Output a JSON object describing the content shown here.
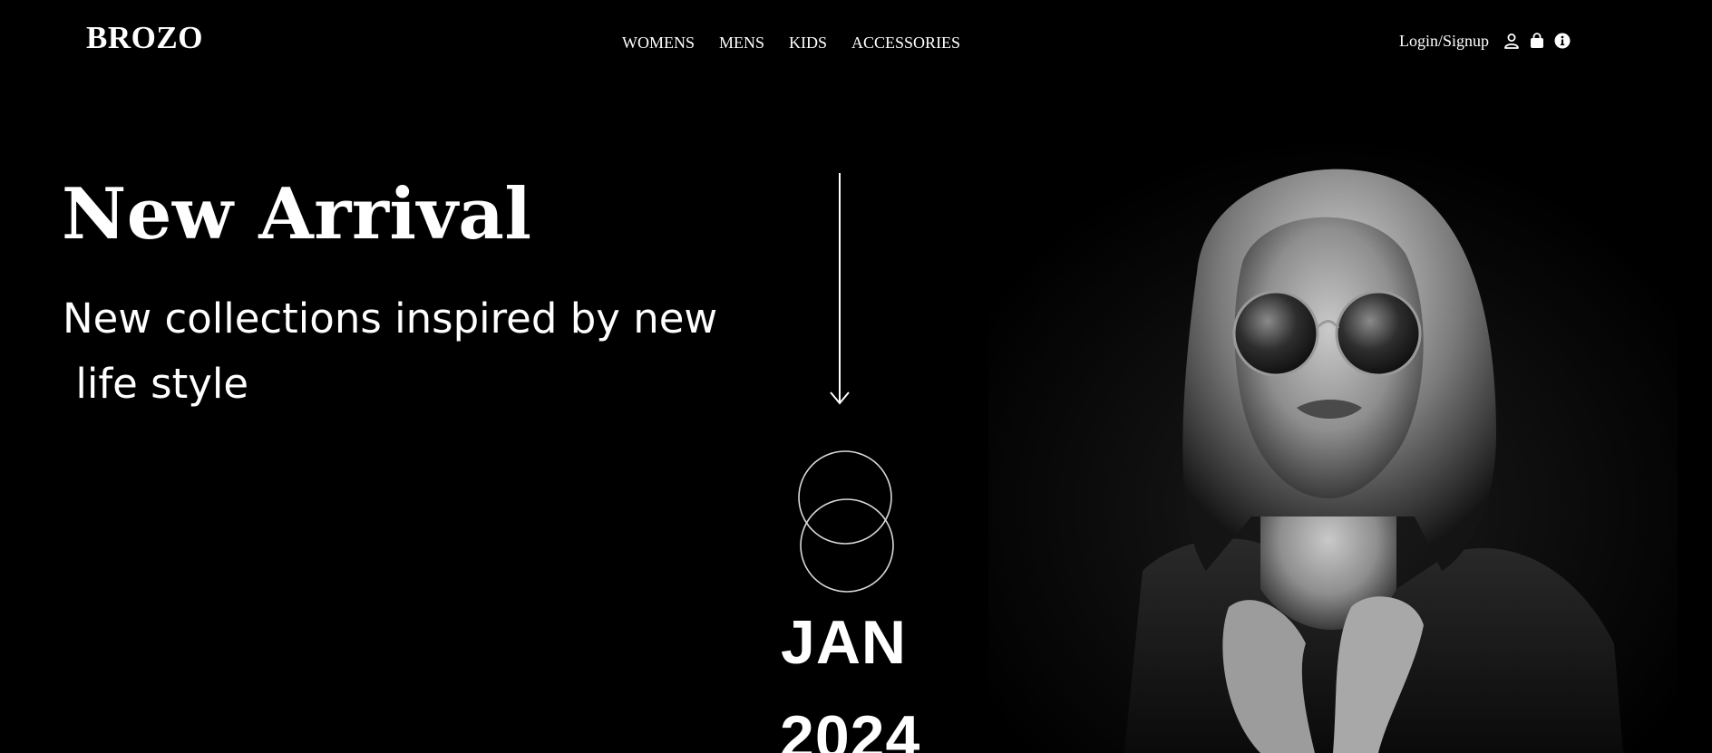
{
  "header": {
    "brand": "BROZO",
    "nav": [
      {
        "label": "WOMENS"
      },
      {
        "label": "MENS"
      },
      {
        "label": "KIDS"
      },
      {
        "label": "ACCESSORIES"
      }
    ],
    "login_label": "Login/Signup",
    "icons": [
      "user-icon",
      "shopping-bag-icon",
      "info-icon"
    ]
  },
  "hero": {
    "title": "New Arrival",
    "subtitle": "New collections inspired by new\n life style",
    "month": "JAN",
    "year": "2024"
  },
  "colors": {
    "background": "#000000",
    "text": "#ffffff"
  }
}
